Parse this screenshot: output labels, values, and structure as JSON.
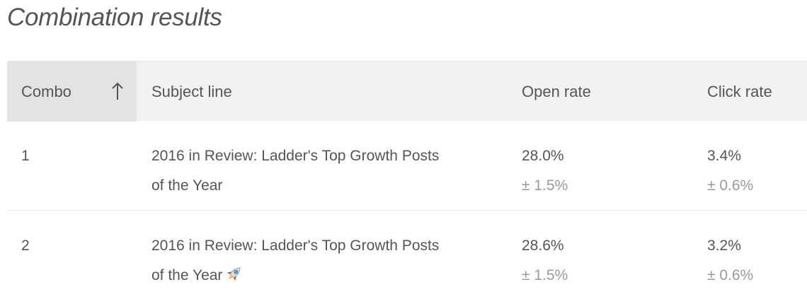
{
  "page": {
    "title": "Combination results"
  },
  "table": {
    "headers": {
      "combo": "Combo",
      "subject": "Subject line",
      "open_rate": "Open rate",
      "click_rate": "Click rate"
    },
    "sort": {
      "column": "combo",
      "direction": "ascending",
      "icon": "arrow-up-icon"
    },
    "rows": [
      {
        "combo": "1",
        "subject_line1": "2016 in Review: Ladder's Top Growth Posts",
        "subject_line2": "of the Year",
        "open_rate": "28.0%",
        "open_rate_error": "± 1.5%",
        "click_rate": "3.4%",
        "click_rate_error": "± 0.6%"
      },
      {
        "combo": "2",
        "subject_line1": "2016 in Review: Ladder's Top Growth Posts",
        "subject_line2": "of the Year",
        "subject_emoji": "rocket-emoji",
        "open_rate": "28.6%",
        "open_rate_error": "± 1.5%",
        "click_rate": "3.2%",
        "click_rate_error": "± 0.6%"
      }
    ]
  },
  "colors": {
    "text": "#555555",
    "muted": "#9a9a9a",
    "header_bg": "#f2f2f2",
    "sorted_header_bg": "#e3e3e3"
  }
}
